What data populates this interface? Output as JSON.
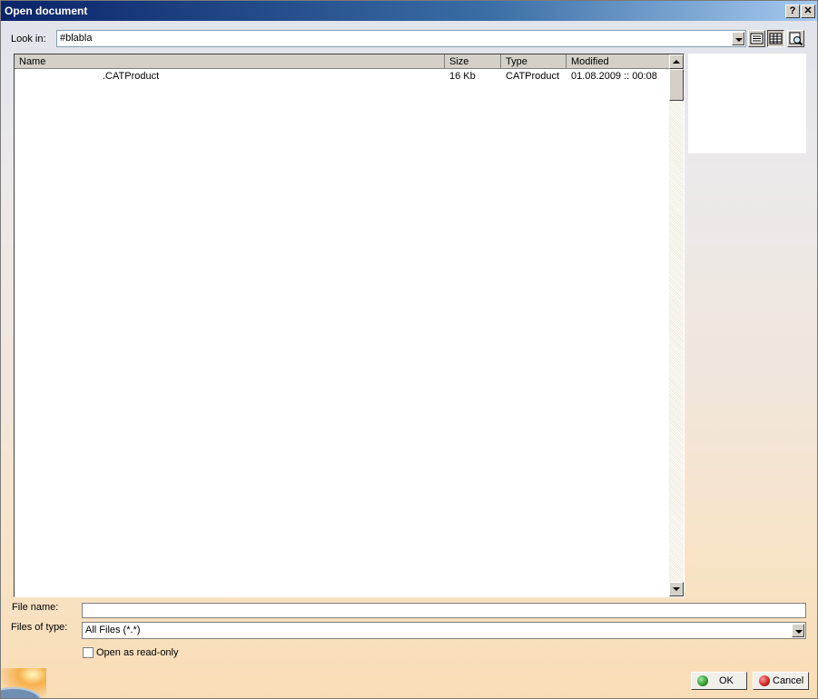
{
  "window": {
    "title": "Open document",
    "help_glyph": "?",
    "close_glyph": "✕"
  },
  "lookin": {
    "label": "Look in:",
    "value": "#blabla"
  },
  "view_buttons": [
    {
      "icon": "list-view-icon"
    },
    {
      "icon": "details-view-icon"
    },
    {
      "icon": "preview-icon"
    }
  ],
  "filelist": {
    "columns": [
      "Name",
      "Size",
      "Type",
      "Modified"
    ],
    "rows": [
      {
        "name": ".CATProduct",
        "size": "16 Kb",
        "type": "CATProduct",
        "modified": "01.08.2009 :: 00:08"
      }
    ]
  },
  "filename": {
    "label": "File name:",
    "value": ""
  },
  "filetype": {
    "label": "Files of type:",
    "value": "All Files (*.*)"
  },
  "readonly": {
    "label": "Open as read-only",
    "checked": false
  },
  "buttons": {
    "ok": "OK",
    "cancel": "Cancel"
  },
  "colors": {
    "ok_icon": "#2e9a2e",
    "cancel_icon": "#cc2020",
    "title_bar": "#0a246a"
  }
}
